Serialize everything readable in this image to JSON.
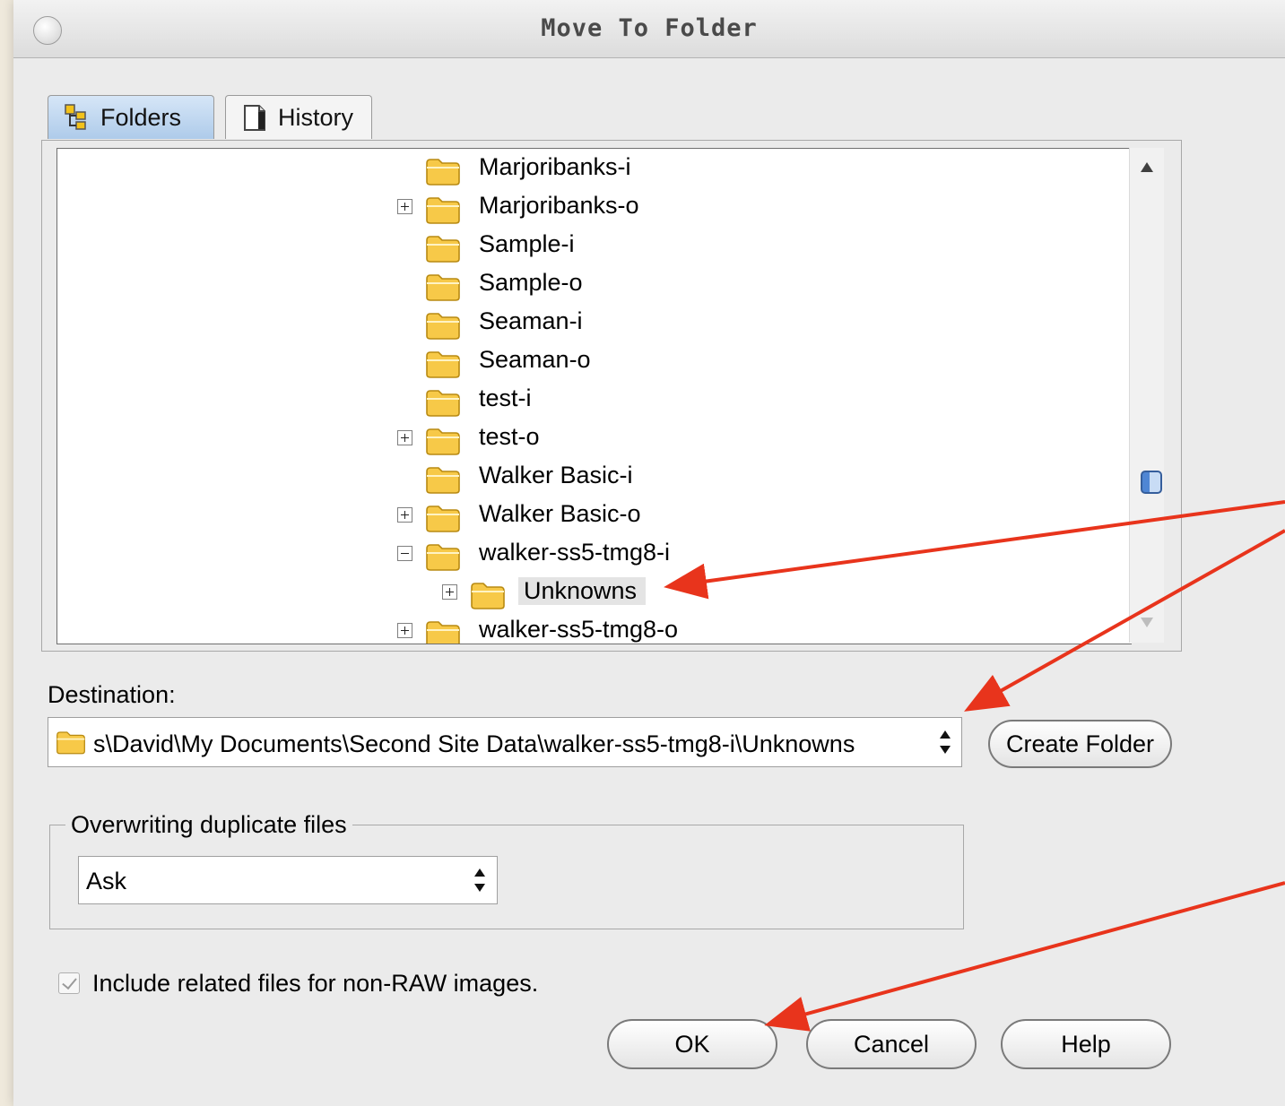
{
  "window": {
    "title": "Move To Folder"
  },
  "tabs": [
    {
      "label": "Folders",
      "icon": "folders-tree-icon",
      "active": true
    },
    {
      "label": "History",
      "icon": "history-page-icon",
      "active": false
    }
  ],
  "tree": {
    "items": [
      {
        "label": "Marjoribanks-i",
        "expander": "none",
        "selected": false
      },
      {
        "label": "Marjoribanks-o",
        "expander": "plus",
        "selected": false
      },
      {
        "label": "Sample-i",
        "expander": "none",
        "selected": false
      },
      {
        "label": "Sample-o",
        "expander": "none",
        "selected": false
      },
      {
        "label": "Seaman-i",
        "expander": "none",
        "selected": false
      },
      {
        "label": "Seaman-o",
        "expander": "none",
        "selected": false
      },
      {
        "label": "test-i",
        "expander": "none",
        "selected": false
      },
      {
        "label": "test-o",
        "expander": "plus",
        "selected": false
      },
      {
        "label": "Walker Basic-i",
        "expander": "none",
        "selected": false
      },
      {
        "label": "Walker Basic-o",
        "expander": "plus",
        "selected": false
      },
      {
        "label": "walker-ss5-tmg8-i",
        "expander": "minus",
        "selected": false
      },
      {
        "label": "Unknowns",
        "expander": "plus",
        "selected": true
      },
      {
        "label": "walker-ss5-tmg8-o",
        "expander": "plus",
        "selected": false
      }
    ]
  },
  "destination": {
    "label": "Destination:",
    "value": "s\\David\\My Documents\\Second Site Data\\walker-ss5-tmg8-i\\Unknowns",
    "create_folder_label": "Create Folder"
  },
  "overwrite": {
    "group_label": "Overwriting duplicate files",
    "selected": "Ask"
  },
  "include_related": {
    "label": "Include related files for non-RAW images.",
    "checked": true
  },
  "buttons": {
    "ok": "OK",
    "cancel": "Cancel",
    "help": "Help"
  },
  "colors": {
    "annotation_arrow": "#e8341c",
    "folder_fill": "#f7c948",
    "tab_active": "#aecbea"
  }
}
